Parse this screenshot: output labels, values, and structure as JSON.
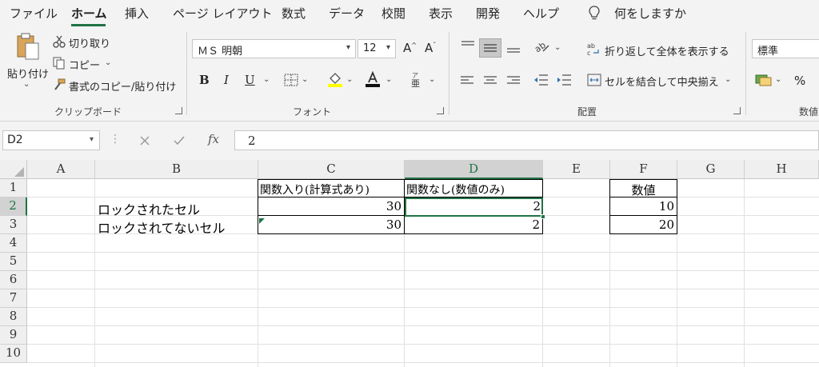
{
  "tabs": [
    {
      "label": "ファイル",
      "active": false
    },
    {
      "label": "ホーム",
      "active": true
    },
    {
      "label": "挿入",
      "active": false
    },
    {
      "label": "ページ レイアウト",
      "active": false
    },
    {
      "label": "数式",
      "active": false
    },
    {
      "label": "データ",
      "active": false
    },
    {
      "label": "校閲",
      "active": false
    },
    {
      "label": "表示",
      "active": false
    },
    {
      "label": "開発",
      "active": false
    },
    {
      "label": "ヘルプ",
      "active": false
    }
  ],
  "tell_me": "何をしますか",
  "clipboard": {
    "paste_label": "貼り付け",
    "cut_label": "切り取り",
    "copy_label": "コピー",
    "format_painter_label": "書式のコピー/貼り付け",
    "group_label": "クリップボード"
  },
  "font": {
    "font_name": "ＭＳ 明朝",
    "font_size": "12",
    "group_label": "フォント",
    "bold": "B",
    "italic": "I",
    "underline": "U"
  },
  "alignment": {
    "wrap_text_label": "折り返して全体を表示する",
    "merge_center_label": "セルを結合して中央揃え",
    "group_label": "配置"
  },
  "number": {
    "format": "標準",
    "percent": "%",
    "group_label": "数値"
  },
  "formula_bar": {
    "name_box": "D2",
    "fx": "fx",
    "value": "2"
  },
  "columns": [
    "A",
    "B",
    "C",
    "D",
    "E",
    "F",
    "G",
    "H"
  ],
  "selected_column": "D",
  "rows": [
    "1",
    "2",
    "3",
    "4",
    "5",
    "6",
    "7",
    "8",
    "9",
    "10"
  ],
  "selected_row": "2",
  "cells": {
    "C1": "関数入り(計算式あり)",
    "D1": "関数なし(数値のみ)",
    "F1": "数値",
    "B2": "ロックされたセル",
    "C2": "30",
    "D2": "2",
    "F2": "10",
    "B3": "ロックされてないセル",
    "C3": "30",
    "D3": "2",
    "F3": "20"
  },
  "colors": {
    "accent": "#217346",
    "ribbon_bg": "#f3f3f3",
    "header_bg": "#efefef",
    "gridline": "#e1e1e1"
  },
  "icons": [
    "paste-icon",
    "cut-icon",
    "copy-icon",
    "format-painter-icon",
    "lightbulb-icon",
    "fill-color-icon",
    "font-color-icon",
    "borders-icon",
    "phonetic-icon",
    "align-top-icon",
    "align-middle-icon",
    "align-bottom-icon",
    "orientation-icon",
    "align-left-icon",
    "align-center-icon",
    "align-right-icon",
    "decrease-indent-icon",
    "increase-indent-icon",
    "wrap-text-icon",
    "merge-center-icon",
    "accounting-format-icon",
    "cancel-icon",
    "enter-icon",
    "select-all-icon"
  ]
}
